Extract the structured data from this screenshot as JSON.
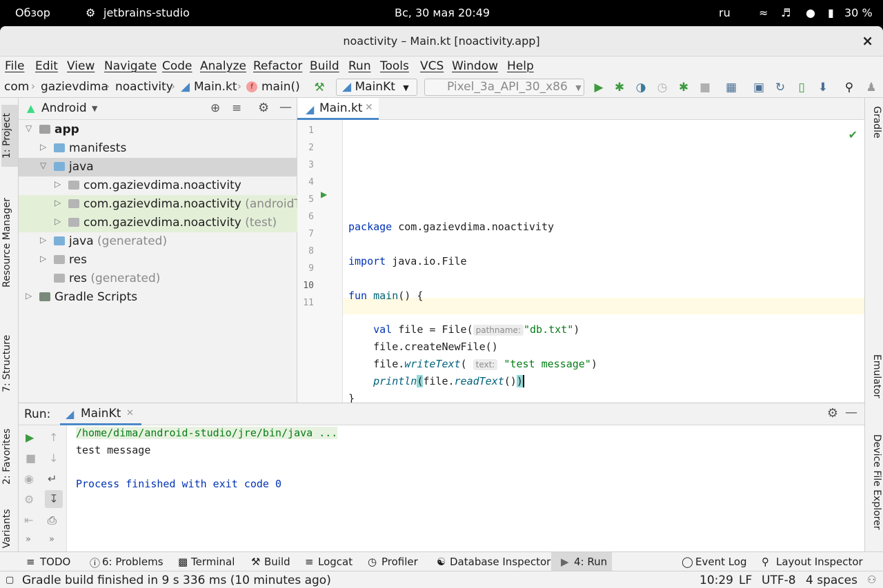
{
  "system_bar": {
    "overview": "Обзор",
    "app": "jetbrains-studio",
    "clock": "Вс, 30 мая  20:49",
    "lang": "ru",
    "battery": "30 %"
  },
  "window": {
    "title": "noactivity – Main.kt [noactivity.app]",
    "close": "×"
  },
  "menu": [
    "File",
    "Edit",
    "View",
    "Navigate",
    "Code",
    "Analyze",
    "Refactor",
    "Build",
    "Run",
    "Tools",
    "VCS",
    "Window",
    "Help"
  ],
  "breadcrumb": [
    "com",
    "gazievdima",
    "noactivity",
    "Main.kt",
    "main()"
  ],
  "toolbar": {
    "run_config": "MainKt",
    "device": "Pixel_3a_API_30_x86"
  },
  "left_tabs": [
    "1: Project",
    "Resource Manager",
    "7: Structure",
    "2: Favorites",
    "Build Variants"
  ],
  "right_tabs": [
    "Gradle",
    "Emulator",
    "Device File Explorer"
  ],
  "project": {
    "view": "Android",
    "tree": [
      {
        "label": "app",
        "extra": "",
        "depth": 0,
        "expanded": true,
        "icon": "module"
      },
      {
        "label": "manifests",
        "extra": "",
        "depth": 1,
        "expanded": false,
        "icon": "folder"
      },
      {
        "label": "java",
        "extra": "",
        "depth": 1,
        "expanded": true,
        "icon": "folder"
      },
      {
        "label": "com.gazievdima.noactivity",
        "extra": "",
        "depth": 2,
        "expanded": false,
        "icon": "package"
      },
      {
        "label": "com.gazievdima.noactivity",
        "extra": "(androidTest)",
        "depth": 2,
        "expanded": false,
        "icon": "package"
      },
      {
        "label": "com.gazievdima.noactivity",
        "extra": "(test)",
        "depth": 2,
        "expanded": false,
        "icon": "package"
      },
      {
        "label": "java",
        "extra": "(generated)",
        "depth": 1,
        "expanded": false,
        "icon": "folder"
      },
      {
        "label": "res",
        "extra": "",
        "depth": 1,
        "expanded": false,
        "icon": "res"
      },
      {
        "label": "res",
        "extra": "(generated)",
        "depth": 1,
        "expanded": null,
        "icon": "res"
      },
      {
        "label": "Gradle Scripts",
        "extra": "",
        "depth": 0,
        "expanded": false,
        "icon": "gradle"
      }
    ]
  },
  "editor": {
    "tab": "Main.kt",
    "line_numbers": [
      "1",
      "2",
      "3",
      "4",
      "5",
      "6",
      "7",
      "8",
      "9",
      "10",
      "11"
    ],
    "package_line": [
      "package",
      " com.gazievdima.noactivity"
    ],
    "import_line": [
      "import",
      " java.io.File"
    ],
    "fun_line": [
      "fun",
      " main",
      "() {"
    ],
    "val_line": [
      "    ",
      "val",
      " file = File(",
      "pathname:",
      "\"db.txt\"",
      ")"
    ],
    "create_line": "    file.createNewFile()",
    "write_line": [
      "    file.",
      "writeText",
      "( ",
      "text:",
      "\"test message\"",
      ")"
    ],
    "println_line": [
      "    ",
      "println",
      "(",
      "file.",
      "readText",
      "()",
      ")"
    ],
    "close_brace": "}"
  },
  "run_panel": {
    "label": "Run:",
    "tab": "MainKt",
    "output": [
      "/home/dima/android-studio/jre/bin/java ...",
      "test message",
      "",
      "Process finished with exit code 0"
    ]
  },
  "bottom_tabs": [
    {
      "label": "TODO"
    },
    {
      "label": "6: Problems"
    },
    {
      "label": "Terminal"
    },
    {
      "label": "Build"
    },
    {
      "label": "Logcat"
    },
    {
      "label": "Profiler"
    },
    {
      "label": "Database Inspector"
    },
    {
      "label": "4: Run"
    },
    {
      "label": "Event Log"
    },
    {
      "label": "Layout Inspector"
    }
  ],
  "status": {
    "message": "Gradle build finished in 9 s 336 ms (10 minutes ago)",
    "position": "10:29",
    "line_sep": "LF",
    "encoding": "UTF-8",
    "indent": "4 spaces"
  },
  "colors": {
    "keyword": "#0033b3",
    "string": "#067d17",
    "function": "#00627a",
    "selected_tab": "#4a88c7",
    "run_green": "#3d9a3f"
  }
}
